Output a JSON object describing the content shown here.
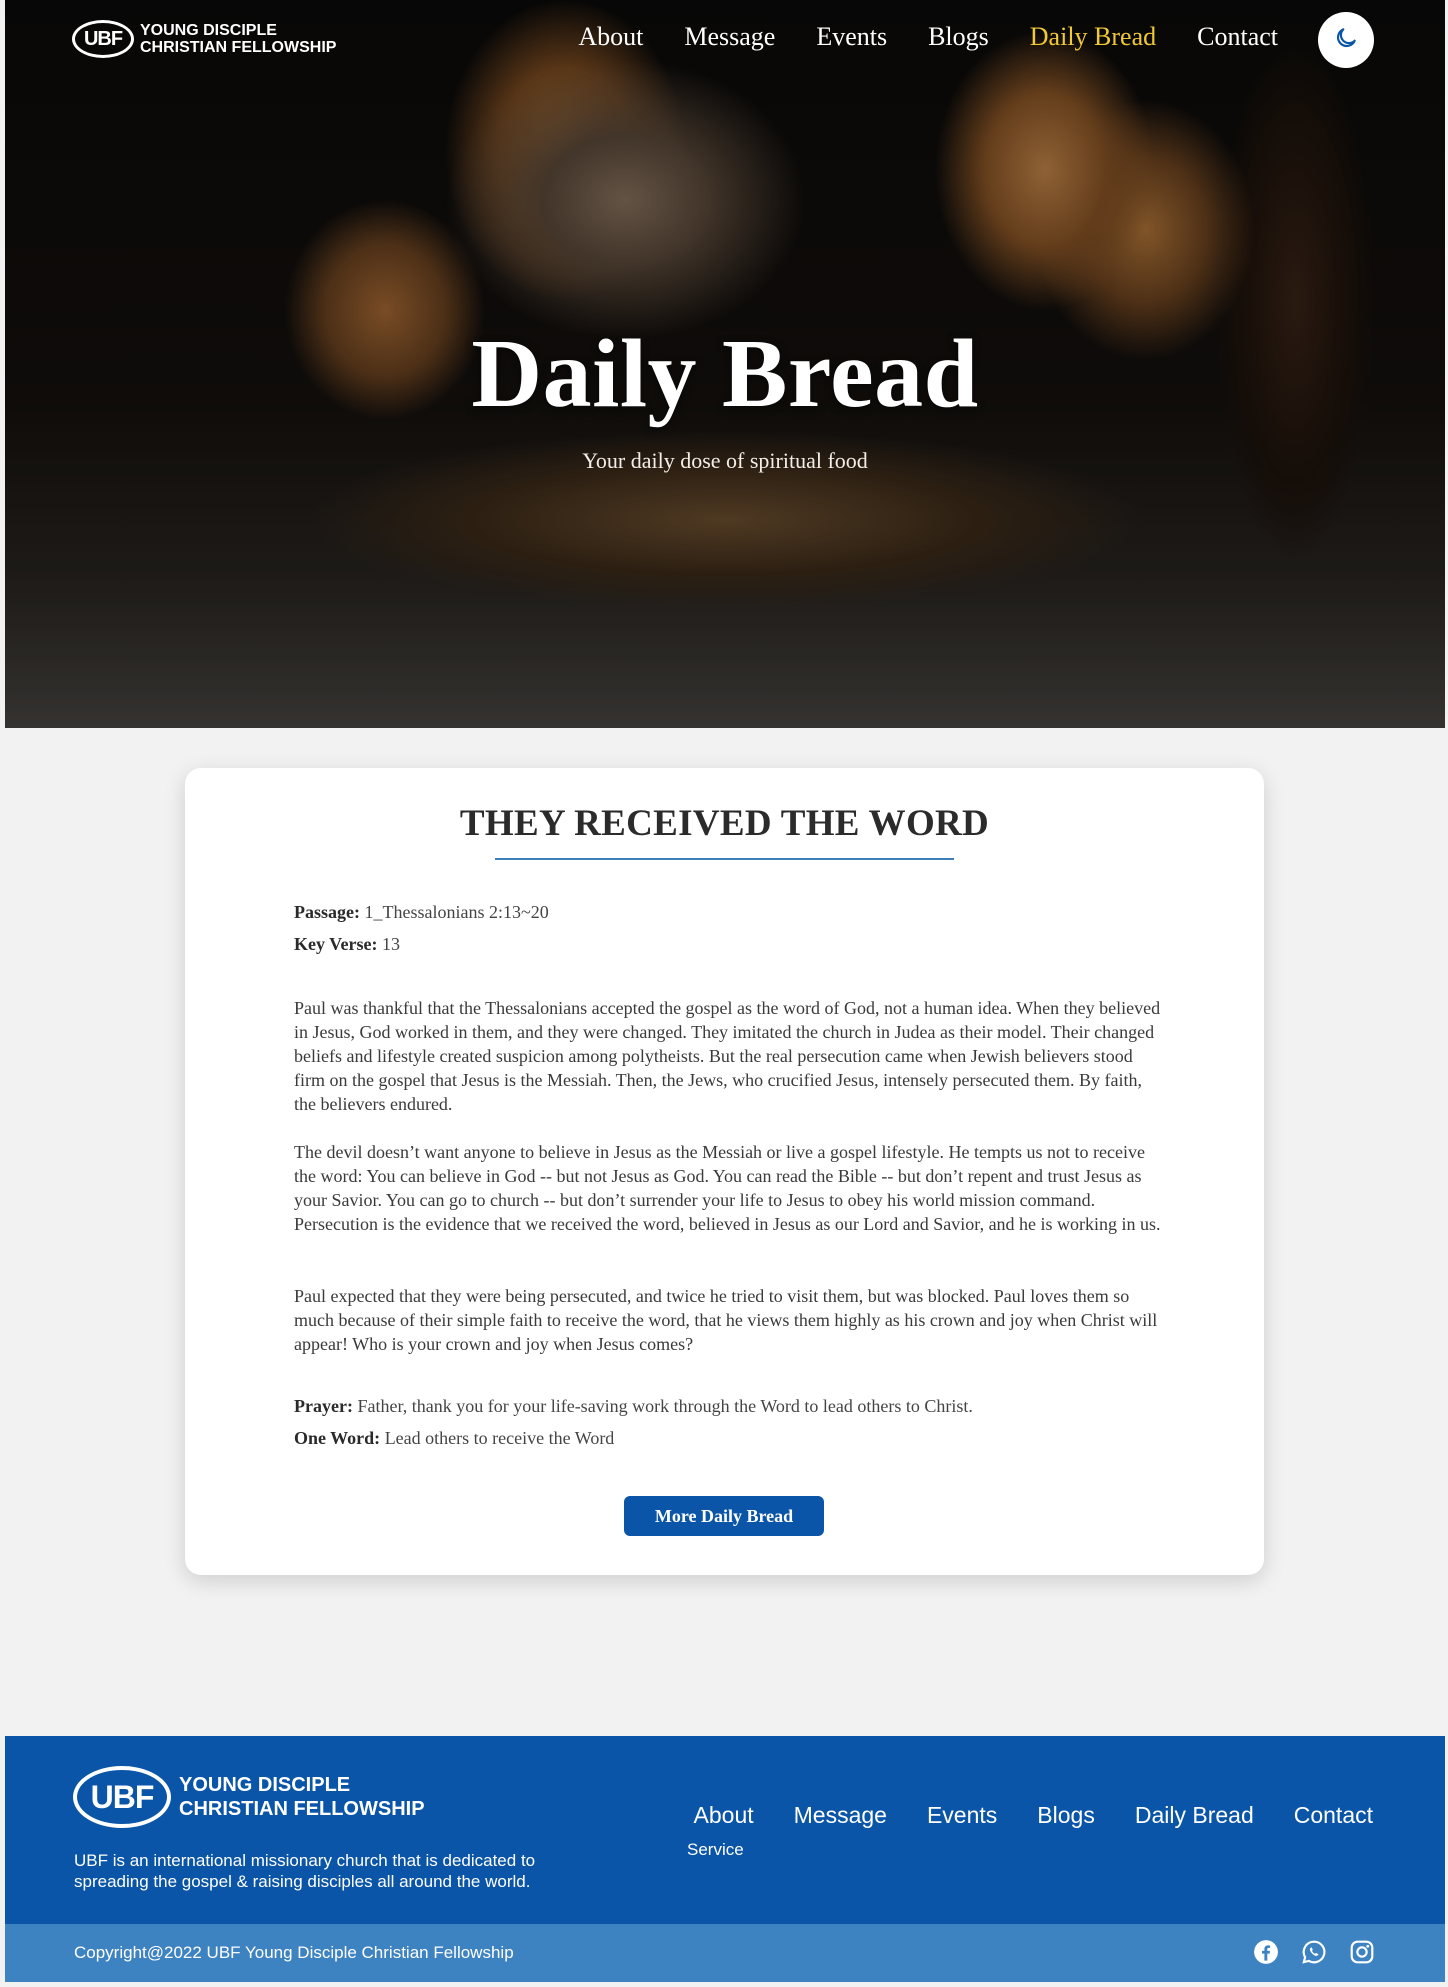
{
  "brand": {
    "logo_mark": "UBF",
    "line1": "YOUNG DISCIPLE",
    "line2": "CHRISTIAN FELLOWSHIP"
  },
  "nav": {
    "items": [
      "About",
      "Message",
      "Events",
      "Blogs",
      "Daily Bread",
      "Contact"
    ],
    "active": "Daily Bread",
    "active_color": "#f0c935"
  },
  "theme_toggle": {
    "icon": "moon-icon"
  },
  "hero": {
    "title": "Daily Bread",
    "subtitle": "Your daily dose of spiritual food"
  },
  "article": {
    "title": "THEY RECEIVED THE WORD",
    "passage_label": "Passage:",
    "passage": "1_Thessalonians 2:13~20",
    "key_verse_label": "Key Verse:",
    "key_verse": "13",
    "paragraphs": [
      "Paul was thankful that the Thessalonians accepted the gospel as the word of God, not a human idea. When they believed in Jesus, God worked in them, and they were changed. They imitated the church in Judea as their model. Their changed beliefs and lifestyle created suspicion among polytheists. But the real persecution came when Jewish believers stood firm on the gospel that Jesus is the Messiah. Then, the Jews, who crucified Jesus, intensely persecuted them. By faith, the believers endured.",
      "The devil doesn’t want anyone to believe in Jesus as the Messiah or live a gospel lifestyle. He tempts us not to receive the word: You can believe in God -- but not Jesus as God. You can read the Bible -- but don’t repent and trust Jesus as your Savior. You can go to church -- but don’t surrender your life to Jesus to obey his world mission command. Persecution is the evidence that we received the word, believed in Jesus as our Lord and Savior, and he is working in us.",
      "Paul expected that they were being persecuted, and twice he tried to visit them, but was blocked. Paul loves them so much because of their simple faith to receive the word, that he views them highly as his crown and joy when Christ will appear! Who is your crown and joy when Jesus comes?"
    ],
    "prayer_label": "Prayer:",
    "prayer": "Father, thank you for your life-saving work through the Word to lead others to Christ.",
    "one_word_label": "One Word:",
    "one_word": "Lead others to receive the Word",
    "more_button": "More Daily Bread"
  },
  "footer": {
    "logo_mark": "UBF",
    "line1": "YOUNG DISCIPLE",
    "line2": "CHRISTIAN FELLOWSHIP",
    "description": "UBF is an international missionary church that is dedicated to spreading the gospel & raising disciples all around the world.",
    "links": [
      "About",
      "Message",
      "Events",
      "Blogs",
      "Daily Bread",
      "Contact"
    ],
    "sub_link": "Service",
    "copyright": "Copyright@2022 UBF Young Disciple Christian Fellowship",
    "socials": [
      "facebook-icon",
      "whatsapp-icon",
      "instagram-icon"
    ],
    "color": "#0a55a8",
    "bar_color": "#3d82c1"
  }
}
